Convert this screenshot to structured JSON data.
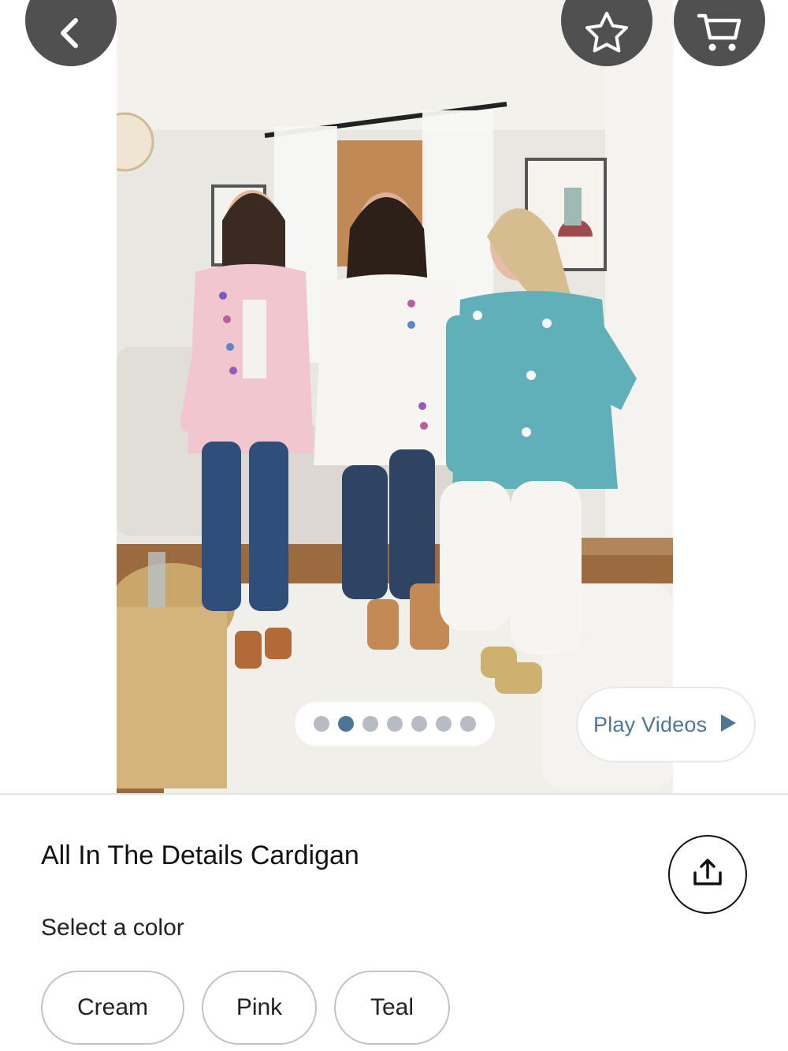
{
  "header": {
    "back_icon": "chevron-left-icon",
    "favorite_icon": "star-outline-icon",
    "cart_icon": "shopping-cart-icon"
  },
  "gallery": {
    "image_count": 7,
    "active_index": 1,
    "dot_color": "#b7bcc4",
    "active_dot_color": "#4e7596",
    "play_videos_label": "Play Videos",
    "play_icon": "play-triangle-icon"
  },
  "product": {
    "title": "All In The Details Cardigan",
    "share_icon": "share-upload-icon",
    "color_prompt": "Select a color",
    "colors": [
      "Cream",
      "Pink",
      "Teal"
    ]
  },
  "colors": {
    "accent": "#4e7596",
    "button_bg": "#505050"
  }
}
